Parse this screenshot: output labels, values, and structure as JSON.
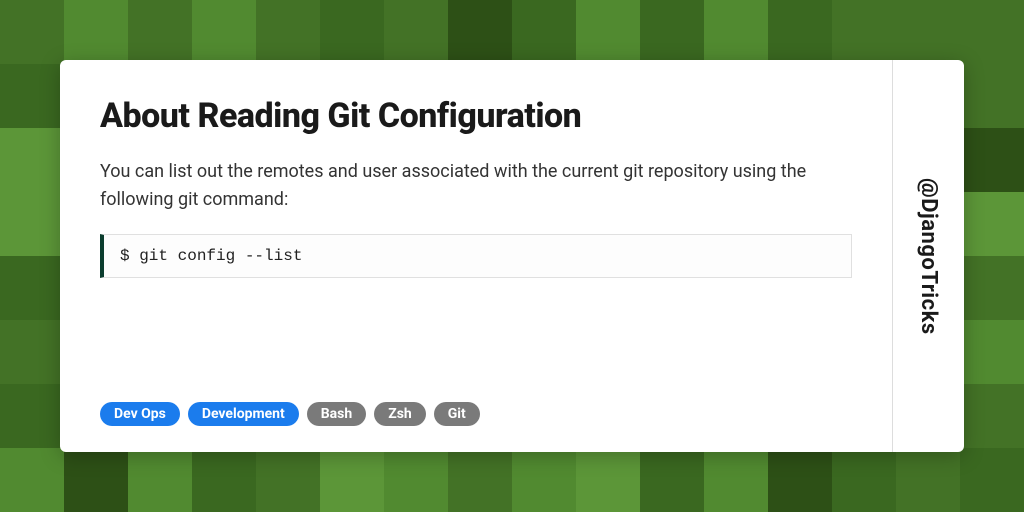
{
  "title": "About Reading Git Configuration",
  "description": "You can list out the remotes and user associated with the current git repository using the following git command:",
  "code": "$ git config --list",
  "tags": [
    {
      "label": "Dev Ops",
      "style": "blue"
    },
    {
      "label": "Development",
      "style": "blue"
    },
    {
      "label": "Bash",
      "style": "gray"
    },
    {
      "label": "Zsh",
      "style": "gray"
    },
    {
      "label": "Git",
      "style": "gray"
    }
  ],
  "handle": "@DjangoTricks"
}
